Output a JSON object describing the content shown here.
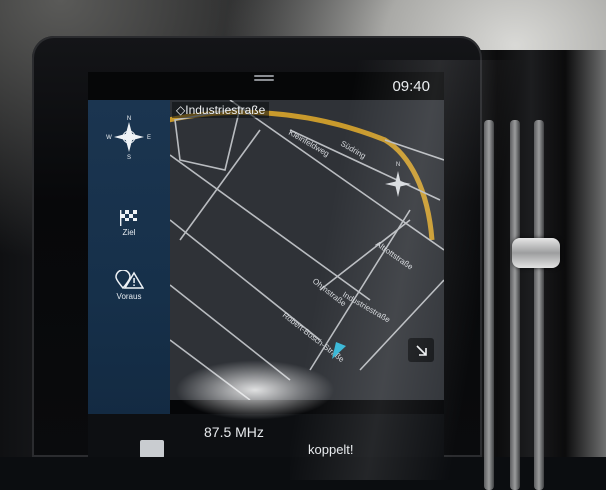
{
  "status": {
    "time": "09:40"
  },
  "navigation": {
    "current_street": "Industriestraße",
    "streets": {
      "kleinfeldweg": "Kleinfeldweg",
      "sudring": "Südring",
      "altrottstrasse": "Altrottstraße",
      "ohmstrasse": "Ohmstraße",
      "industriestrasse": "Industriestraße",
      "robert_bosch": "Robert-Bosch-Straße"
    }
  },
  "sidebar": {
    "items": [
      {
        "icon": "compass-icon",
        "label": ""
      },
      {
        "icon": "checkered-flag-icon",
        "label": "Ziel"
      },
      {
        "icon": "pin-warning-icon",
        "label": "Voraus"
      }
    ]
  },
  "audio": {
    "frequency": "87.5 MHz",
    "message": "koppelt!"
  }
}
